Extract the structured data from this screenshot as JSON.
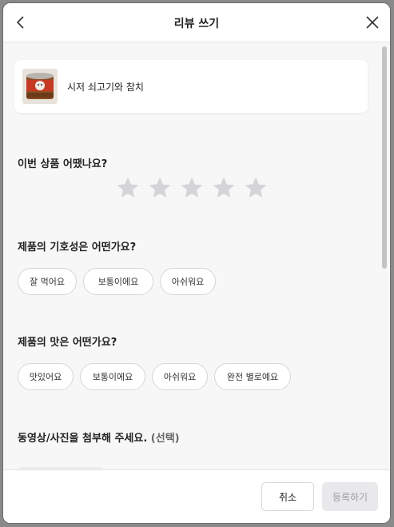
{
  "header": {
    "title": "리뷰 쓰기",
    "back_icon": "chevron-left-icon",
    "close_icon": "close-icon"
  },
  "product": {
    "name": "시저 쇠고기와 참치",
    "image_icon": "product-can-image"
  },
  "rating": {
    "question": "이번 상품 어땠나요?",
    "max_stars": 5,
    "selected": 0,
    "star_color": "#d5d5d8"
  },
  "preference": {
    "question": "제품의 기호성은 어떤가요?",
    "options": [
      "잘 먹어요",
      "보통이에요",
      "아쉬워요"
    ]
  },
  "taste": {
    "question": "제품의 맛은 어떤가요?",
    "options": [
      "맛있어요",
      "보통이에요",
      "아쉬워요",
      "완전 별로예요"
    ]
  },
  "media": {
    "question": "동영상/사진을 첨부해 주세요.",
    "optional_label": "(선택)"
  },
  "footer": {
    "cancel_label": "취소",
    "submit_label": "등록하기"
  }
}
